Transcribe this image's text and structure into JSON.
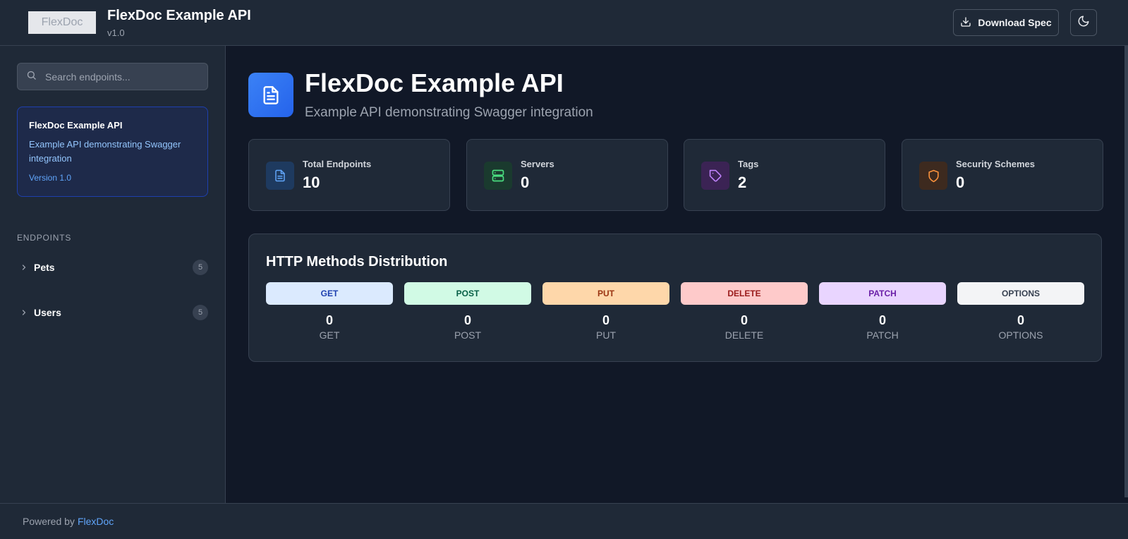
{
  "header": {
    "logo_text": "FlexDoc",
    "title": "FlexDoc Example API",
    "version": "v1.0",
    "download_label": "Download Spec",
    "download_icon": "download-icon",
    "theme_icon": "moon-icon"
  },
  "sidebar": {
    "search_placeholder": "Search endpoints...",
    "info": {
      "title": "FlexDoc Example API",
      "description": "Example API demonstrating Swagger integration",
      "version": "Version 1.0"
    },
    "section_label": "ENDPOINTS",
    "groups": [
      {
        "label": "Pets",
        "count": "5"
      },
      {
        "label": "Users",
        "count": "5"
      }
    ]
  },
  "main": {
    "title": "FlexDoc Example API",
    "subtitle": "Example API demonstrating Swagger integration",
    "stats": [
      {
        "label": "Total Endpoints",
        "value": "10",
        "icon": "document-icon",
        "color": "#60a5fa"
      },
      {
        "label": "Servers",
        "value": "0",
        "icon": "server-icon",
        "color": "#4ade80"
      },
      {
        "label": "Tags",
        "value": "2",
        "icon": "tag-icon",
        "color": "#c084fc"
      },
      {
        "label": "Security Schemes",
        "value": "0",
        "icon": "shield-icon",
        "color": "#fb923c"
      }
    ],
    "distribution": {
      "title": "HTTP Methods Distribution",
      "methods": [
        {
          "badge": "GET",
          "count": "0",
          "name": "GET",
          "bg": "#dbeafe",
          "fg": "#1e40af"
        },
        {
          "badge": "POST",
          "count": "0",
          "name": "POST",
          "bg": "#d1fae5",
          "fg": "#065f46"
        },
        {
          "badge": "PUT",
          "count": "0",
          "name": "PUT",
          "bg": "#fed7aa",
          "fg": "#9a3412"
        },
        {
          "badge": "DELETE",
          "count": "0",
          "name": "DELETE",
          "bg": "#fecaca",
          "fg": "#991b1b"
        },
        {
          "badge": "PATCH",
          "count": "0",
          "name": "PATCH",
          "bg": "#e9d5ff",
          "fg": "#6b21a8"
        },
        {
          "badge": "OPTIONS",
          "count": "0",
          "name": "OPTIONS",
          "bg": "#f3f4f6",
          "fg": "#374151"
        }
      ]
    }
  },
  "footer": {
    "text": "Powered by",
    "link": "FlexDoc"
  }
}
